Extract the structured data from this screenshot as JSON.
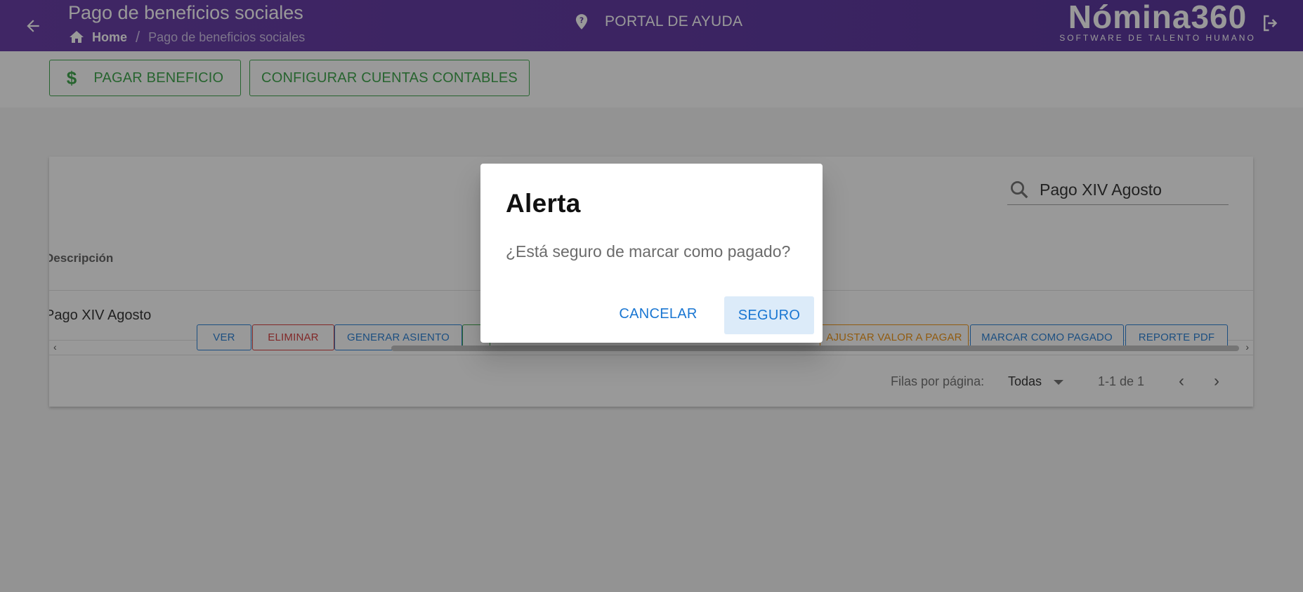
{
  "header": {
    "title": "Pago de beneficios sociales",
    "breadcrumb": {
      "home": "Home",
      "current": "Pago de beneficios sociales"
    },
    "help_label": "PORTAL DE AYUDA",
    "logo_brand": "Nómina360",
    "logo_tagline": "SOFTWARE DE TALENTO HUMANO",
    "bg_color": "#53289a"
  },
  "actions": {
    "pay_label": "PAGAR BENEFICIO",
    "pay_icon": "$",
    "config_label": "CONFIGURAR CUENTAS CONTABLES"
  },
  "table": {
    "search_value": "Pago XIV Agosto",
    "column_header": "Descripción",
    "rows": [
      {
        "description": "Pago XIV Agosto"
      }
    ],
    "row_buttons": {
      "view": "VER",
      "delete": "ELIMINAR",
      "generate_entry": "GENERAR ASIENTO",
      "adjust": "AJUSTAR VALOR A PAGAR",
      "mark_paid": "MARCAR COMO PAGADO",
      "pdf_report": "REPORTE PDF"
    },
    "footer": {
      "rows_per_page_label": "Filas por página:",
      "rows_per_page_value": "Todas",
      "range": "1-1 de 1"
    }
  },
  "dialog": {
    "title": "Alerta",
    "message": "¿Está seguro de marcar como pagado?",
    "cancel_label": "CANCELAR",
    "confirm_label": "SEGURO"
  },
  "colors": {
    "primary": "#1976d2",
    "success": "#2e9d3c",
    "danger": "#d32f2f",
    "warning": "#f08c00"
  }
}
